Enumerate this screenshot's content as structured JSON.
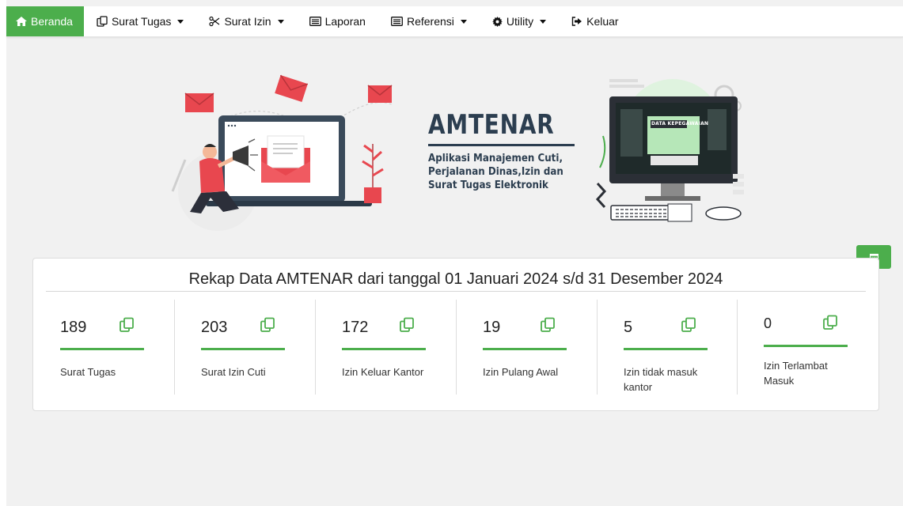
{
  "nav": {
    "items": [
      {
        "label": "Beranda",
        "icon": "home-icon",
        "active": true,
        "dropdown": false
      },
      {
        "label": "Surat Tugas",
        "icon": "copy-icon",
        "active": false,
        "dropdown": true
      },
      {
        "label": "Surat Izin",
        "icon": "scissors-icon",
        "active": false,
        "dropdown": true
      },
      {
        "label": "Laporan",
        "icon": "list-icon",
        "active": false,
        "dropdown": false
      },
      {
        "label": "Referensi",
        "icon": "list-icon",
        "active": false,
        "dropdown": true
      },
      {
        "label": "Utility",
        "icon": "gear-icon",
        "active": false,
        "dropdown": true
      },
      {
        "label": "Keluar",
        "icon": "sign-out-icon",
        "active": false,
        "dropdown": false
      }
    ]
  },
  "banner": {
    "title": "AMTENAR",
    "subtitle_lines": [
      "Aplikasi Manajemen Cuti,",
      "Perjalanan Dinas,Izin dan",
      "Surat Tugas Elektronik"
    ],
    "screen_label": "DATA KEPEGAWAIAN"
  },
  "recap": {
    "title": "Rekap Data AMTENAR dari tanggal 01 Januari 2024 s/d 31 Desember 2024",
    "stats": [
      {
        "value": "189",
        "label": "Surat Tugas"
      },
      {
        "value": "203",
        "label": "Surat Izin Cuti"
      },
      {
        "value": "172",
        "label": "Izin Keluar Kantor"
      },
      {
        "value": "19",
        "label": "Izin Pulang Awal"
      },
      {
        "value": "5",
        "label": "Izin tidak masuk kantor"
      },
      {
        "value": "0",
        "label": "Izin Terlambat Masuk"
      }
    ]
  },
  "colors": {
    "accent": "#4cae4c",
    "banner_text": "#2c3e50",
    "envelope_red": "#e8474f",
    "background": "#f1f1f1"
  }
}
